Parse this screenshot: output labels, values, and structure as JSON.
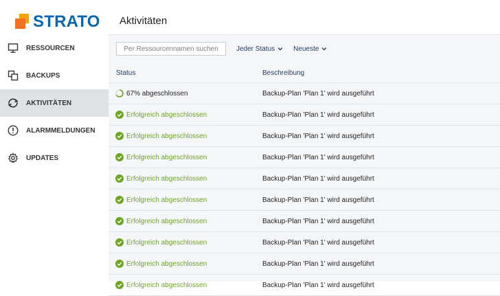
{
  "brand": {
    "name": "STRATO",
    "colors": {
      "blue": "#0b66b0",
      "orange": "#f36f21",
      "amber": "#f7a200"
    }
  },
  "nav": {
    "items": [
      {
        "label": "RESSOURCEN",
        "icon": "monitor-icon",
        "active": false
      },
      {
        "label": "BACKUPS",
        "icon": "copy-icon",
        "active": false
      },
      {
        "label": "AKTIVITÄTEN",
        "icon": "sync-icon",
        "active": true
      },
      {
        "label": "ALARMMELDUNGEN",
        "icon": "alert-icon",
        "active": false
      },
      {
        "label": "UPDATES",
        "icon": "gear-icon",
        "active": false
      }
    ]
  },
  "header": {
    "title": "Aktivitäten"
  },
  "filters": {
    "search_placeholder": "Per Ressourcennamen suchen",
    "status_filter": "Jeder Status",
    "sort": "Neueste"
  },
  "table": {
    "columns": {
      "status": "Status",
      "description": "Beschreibung"
    },
    "rows": [
      {
        "status": "67% abgeschlossen",
        "kind": "progress",
        "progress": 0.67,
        "description": "Backup-Plan 'Plan 1' wird ausgeführt"
      },
      {
        "status": "Erfolgreich abgeschlossen",
        "kind": "success",
        "description": "Backup-Plan 'Plan 1' wird ausgeführt"
      },
      {
        "status": "Erfolgreich abgeschlossen",
        "kind": "success",
        "description": "Backup-Plan 'Plan 1' wird ausgeführt"
      },
      {
        "status": "Erfolgreich abgeschlossen",
        "kind": "success",
        "description": "Backup-Plan 'Plan 1' wird ausgeführt"
      },
      {
        "status": "Erfolgreich abgeschlossen",
        "kind": "success",
        "description": "Backup-Plan 'Plan 1' wird ausgeführt"
      },
      {
        "status": "Erfolgreich abgeschlossen",
        "kind": "success",
        "description": "Backup-Plan 'Plan 1' wird ausgeführt"
      },
      {
        "status": "Erfolgreich abgeschlossen",
        "kind": "success",
        "description": "Backup-Plan 'Plan 1' wird ausgeführt"
      },
      {
        "status": "Erfolgreich abgeschlossen",
        "kind": "success",
        "description": "Backup-Plan 'Plan 1' wird ausgeführt"
      },
      {
        "status": "Erfolgreich abgeschlossen",
        "kind": "success",
        "description": "Backup-Plan 'Plan 1' wird ausgeführt"
      },
      {
        "status": "Erfolgreich abgeschlossen",
        "kind": "success",
        "description": "Backup-Plan 'Plan 1' wird ausgeführt"
      }
    ]
  }
}
